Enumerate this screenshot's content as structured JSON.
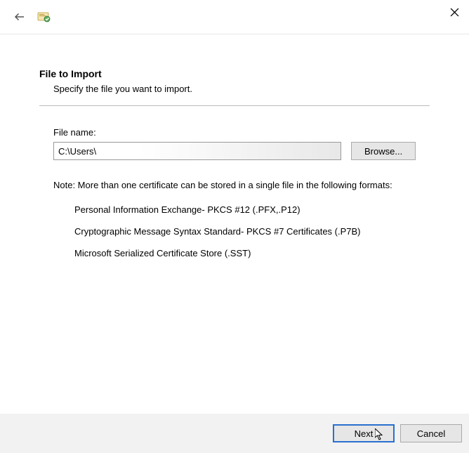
{
  "header": {
    "title": "File to Import",
    "subtitle": "Specify the file you want to import."
  },
  "file": {
    "label": "File name:",
    "value": "C:\\Users\\",
    "browse_label": "Browse..."
  },
  "note": {
    "intro": "Note:  More than one certificate can be stored in a single file in the following formats:",
    "formats": [
      "Personal Information Exchange- PKCS #12 (.PFX,.P12)",
      "Cryptographic Message Syntax Standard- PKCS #7 Certificates (.P7B)",
      "Microsoft Serialized Certificate Store (.SST)"
    ]
  },
  "footer": {
    "next": "Next",
    "cancel": "Cancel"
  }
}
